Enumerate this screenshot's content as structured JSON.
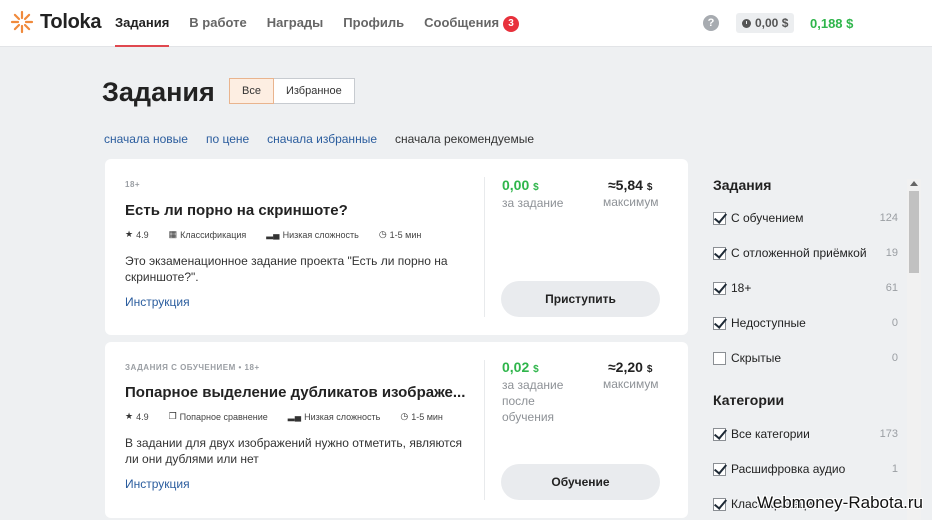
{
  "header": {
    "logo_text": "Toloka",
    "nav": [
      "Задания",
      "В работе",
      "Награды",
      "Профиль",
      "Сообщения"
    ],
    "messages_badge": "3",
    "help_label": "?",
    "balance_pending": "0,00 $",
    "balance_available": "0,188 $"
  },
  "page": {
    "title": "Задания",
    "filters": [
      "Все",
      "Избранное"
    ],
    "sort": [
      "сначала новые",
      "по цене",
      "сначала избранные",
      "сначала рекомендуемые"
    ]
  },
  "cards": [
    {
      "tags": "18+",
      "title": "Есть ли порно на скриншоте?",
      "rating": "4.9",
      "category": "Классификация",
      "difficulty": "Низкая сложность",
      "duration": "1-5 мин",
      "description": "Это экзаменационное задание проекта \"Есть ли порно на скриншоте?\".",
      "instruction": "Инструкция",
      "price": "0,00",
      "price_label": "за задание",
      "max": "≈5,84",
      "max_label": "максимум",
      "currency": "$",
      "action": "Приступить"
    },
    {
      "tags": "ЗАДАНИЯ С ОБУЧЕНИЕМ  •  18+",
      "title": "Попарное выделение дубликатов изображе...",
      "rating": "4.9",
      "category": "Попарное сравнение",
      "difficulty": "Низкая сложность",
      "duration": "1-5 мин",
      "description": "В задании для двух изображений нужно отметить, являются ли они дублями или нет",
      "instruction": "Инструкция",
      "price": "0,02",
      "price_label": "за задание после обучения",
      "max": "≈2,20",
      "max_label": "максимум",
      "currency": "$",
      "action": "Обучение"
    }
  ],
  "sidebar": {
    "tasks_heading": "Задания",
    "tasks_filters": [
      {
        "label": "С обучением",
        "count": "124",
        "checked": true
      },
      {
        "label": "С отложенной приёмкой",
        "count": "19",
        "checked": true
      },
      {
        "label": "18+",
        "count": "61",
        "checked": true
      },
      {
        "label": "Недоступные",
        "count": "0",
        "checked": true
      },
      {
        "label": "Скрытые",
        "count": "0",
        "checked": false
      }
    ],
    "categories_heading": "Категории",
    "categories": [
      {
        "label": "Все категории",
        "count": "173",
        "checked": true
      },
      {
        "label": "Расшифровка аудио",
        "count": "1",
        "checked": true
      },
      {
        "label": "Классификация",
        "count": "",
        "checked": true
      }
    ]
  },
  "watermark": "Webmoney-Rabota.ru",
  "colors": {
    "accent": "#e0484f",
    "green": "#2fb54b",
    "link": "#2b5d9e"
  }
}
